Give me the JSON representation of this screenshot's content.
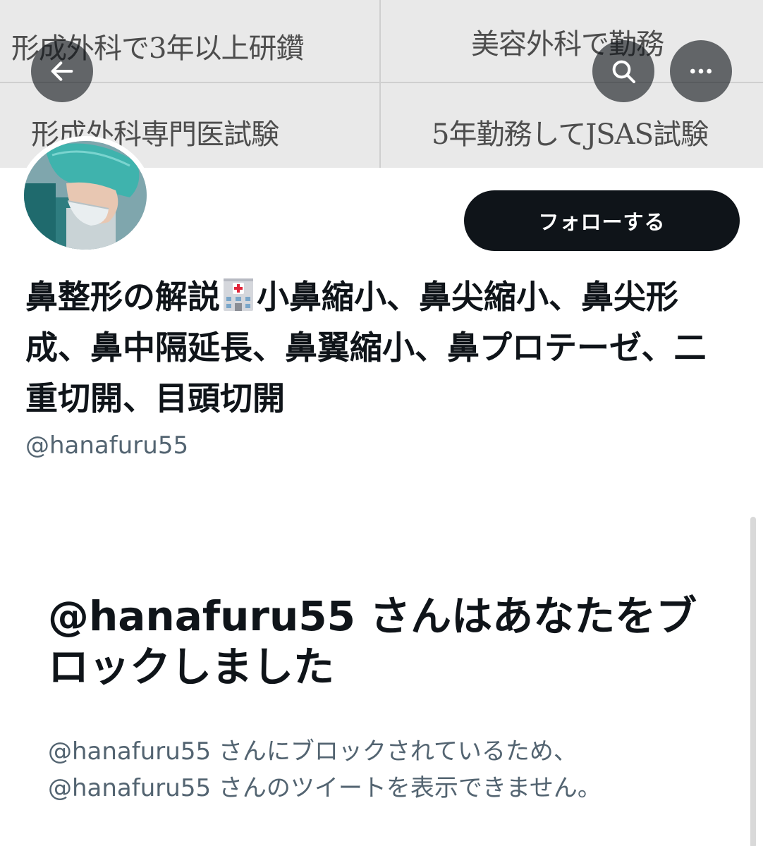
{
  "banner": {
    "cells": [
      "形成外科で3年以上研鑽",
      "美容外科で勤務",
      "形成外科専門医試験",
      "5年勤務してJSAS試験"
    ]
  },
  "header": {
    "back_icon": "arrow-left-icon",
    "search_icon": "search-icon",
    "more_icon": "more-horizontal-icon"
  },
  "profile": {
    "follow_label": "フォローする",
    "name_part1": "鼻整形の解説",
    "name_emoji": "hospital-icon",
    "name_part2": "小鼻縮小、鼻尖縮小、鼻尖形成、鼻中隔延長、鼻翼縮小、鼻プロテーゼ、二重切開、目頭切開",
    "handle": "@hanafuru55"
  },
  "blocked": {
    "title": "@hanafuru55 さんはあなたをブロックしました",
    "line1": "@hanafuru55 さんにブロックされているため、",
    "line2": "@hanafuru55 さんのツイートを表示できません。"
  }
}
